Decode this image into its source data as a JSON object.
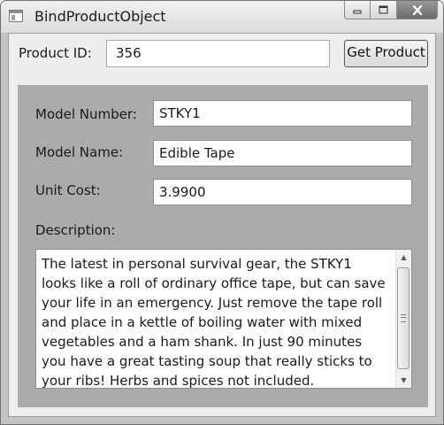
{
  "window": {
    "title": "BindProductObject",
    "app_icon": "window-app-icon",
    "controls": {
      "minimize": "minimize-icon",
      "maximize": "maximize-icon",
      "close": "close-icon"
    }
  },
  "lookup": {
    "product_id_label": "Product ID:",
    "product_id_value": "356",
    "get_button_label": "Get Product"
  },
  "details": {
    "model_number_label": "Model Number:",
    "model_number_value": "STKY1",
    "model_name_label": "Model Name:",
    "model_name_value": "Edible Tape",
    "unit_cost_label": "Unit Cost:",
    "unit_cost_value": "3.9900",
    "description_label": "Description:",
    "description_value": "The latest in personal survival gear, the STKY1 looks like a roll of ordinary office tape, but can save your life in an emergency.  Just remove the tape roll and place in a kettle of boiling water with mixed vegetables and a ham shank. In just 90 minutes you have a great tasting soup that really sticks to your ribs! Herbs and spices not included."
  },
  "colors": {
    "window_frame": "#c4c4c4",
    "client_background": "#eeeeee",
    "details_panel": "#ababab",
    "field_background": "#ffffff"
  }
}
